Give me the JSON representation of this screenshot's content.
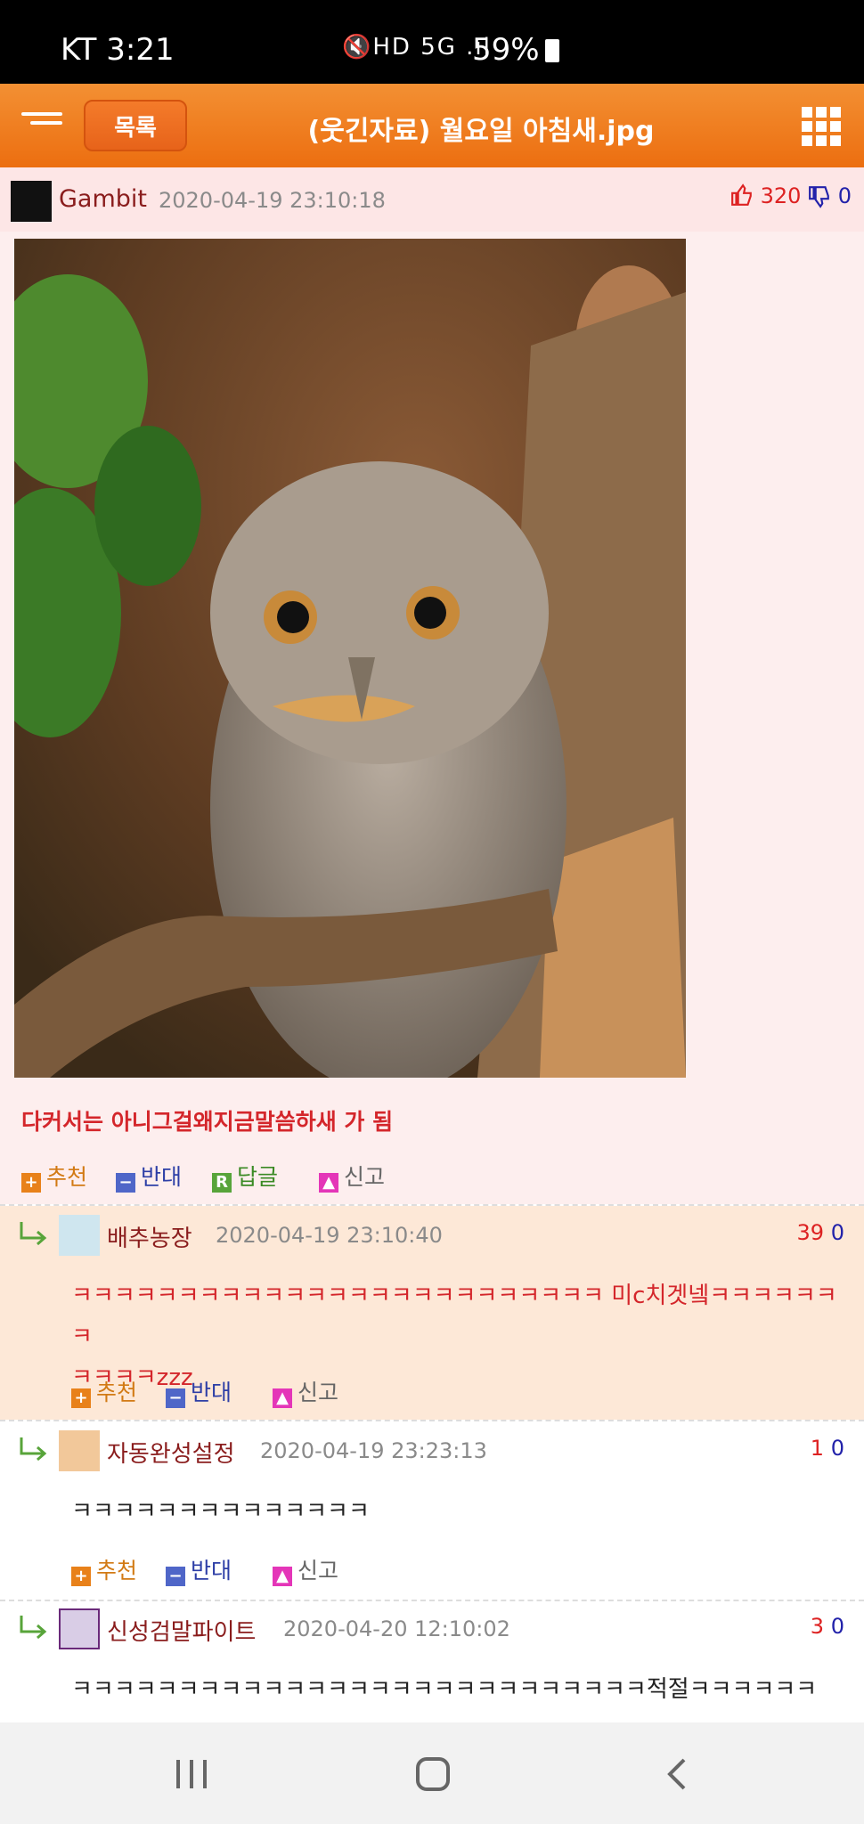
{
  "status_bar": {
    "carrier_time": "KT 3:21",
    "icons": "🔇HD 5G .ıl",
    "battery": "59%"
  },
  "header": {
    "list_button": "목록",
    "title": "(웃긴자료) 월요일 아침새.jpg"
  },
  "post": {
    "author": "Gambit",
    "date": "2020-04-19 23:10:18",
    "upvotes": "320",
    "downvotes": "0",
    "caption": "다커서는 아니그걸왜지금말씀하새 가 됨",
    "actions": {
      "recommend": "추천",
      "oppose": "반대",
      "reply": "답글",
      "report": "신고"
    }
  },
  "comments": [
    {
      "author": "배추농장",
      "date": "2020-04-19 23:10:40",
      "up": "39",
      "down": "0",
      "text_line1": "ㅋㅋㅋㅋㅋㅋㅋㅋㅋㅋㅋㅋㅋㅋㅋㅋㅋㅋㅋㅋㅋㅋㅋㅋㅋ 미c치겟넼ㅋㅋㅋㅋㅋㅋㅋ",
      "text_line2": "ㅋㅋㅋㅋzzz"
    },
    {
      "author": "자동완성설정",
      "date": "2020-04-19 23:23:13",
      "up": "1",
      "down": "0",
      "text_line1": "ㅋㅋㅋㅋㅋㅋㅋㅋㅋㅋㅋㅋㅋㅋ"
    },
    {
      "author": "신성검말파이트",
      "date": "2020-04-20 12:10:02",
      "up": "3",
      "down": "0",
      "text_line1": "ㅋㅋㅋㅋㅋㅋㅋㅋㅋㅋㅋㅋㅋㅋㅋㅋㅋㅋㅋㅋㅋㅋㅋㅋㅋㅋㅋ적절ㅋㅋㅋㅋㅋㅋㅋ"
    }
  ],
  "comment_actions": {
    "recommend": "추천",
    "oppose": "반대",
    "report": "신고"
  },
  "colors": {
    "accent": "#ec6e10",
    "post_bg": "#fdeeee",
    "highlight_comment_bg": "#fde8d7"
  }
}
